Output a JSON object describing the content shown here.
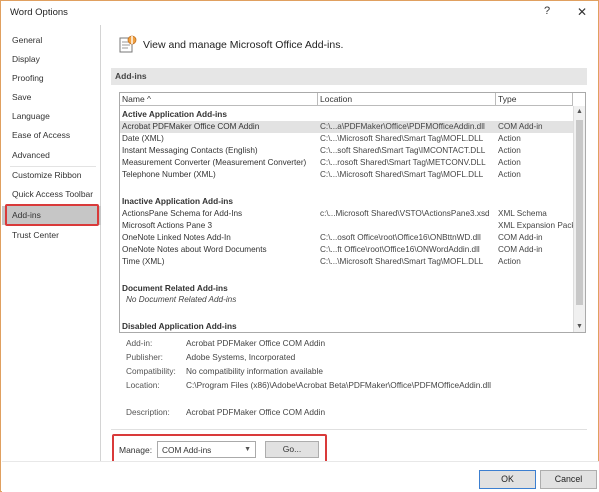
{
  "window": {
    "title": "Word Options",
    "help_glyph": "?",
    "close_glyph": "✕"
  },
  "sidebar": {
    "items": [
      {
        "label": "General"
      },
      {
        "label": "Display"
      },
      {
        "label": "Proofing"
      },
      {
        "label": "Save"
      },
      {
        "label": "Language"
      },
      {
        "label": "Ease of Access"
      },
      {
        "label": "Advanced"
      },
      {
        "label": "Customize Ribbon"
      },
      {
        "label": "Quick Access Toolbar"
      },
      {
        "label": "Add-ins"
      },
      {
        "label": "Trust Center"
      }
    ],
    "active": "Add-ins"
  },
  "main": {
    "header": "View and manage Microsoft Office Add-ins.",
    "section_title": "Add-ins",
    "columns": {
      "name": "Name ^",
      "location": "Location",
      "type": "Type"
    },
    "groups": {
      "active": "Active Application Add-ins",
      "inactive": "Inactive Application Add-ins",
      "document": "Document Related Add-ins",
      "disabled": "Disabled Application Add-ins"
    },
    "active_rows": [
      {
        "name": "Acrobat PDFMaker Office COM Addin",
        "location": "C:\\...a\\PDFMaker\\Office\\PDFMOfficeAddin.dll",
        "type": "COM Add-in"
      },
      {
        "name": "Date (XML)",
        "location": "C:\\...\\Microsoft Shared\\Smart Tag\\MOFL.DLL",
        "type": "Action"
      },
      {
        "name": "Instant Messaging Contacts (English)",
        "location": "C:\\...soft Shared\\Smart Tag\\IMCONTACT.DLL",
        "type": "Action"
      },
      {
        "name": "Measurement Converter (Measurement Converter)",
        "location": "C:\\...rosoft Shared\\Smart Tag\\METCONV.DLL",
        "type": "Action"
      },
      {
        "name": "Telephone Number (XML)",
        "location": "C:\\...\\Microsoft Shared\\Smart Tag\\MOFL.DLL",
        "type": "Action"
      }
    ],
    "inactive_rows": [
      {
        "name": "ActionsPane Schema for Add-Ins",
        "location": "c:\\...Microsoft Shared\\VSTO\\ActionsPane3.xsd",
        "type": "XML Schema"
      },
      {
        "name": "Microsoft Actions Pane 3",
        "location": "",
        "type": "XML Expansion Pack"
      },
      {
        "name": "OneNote Linked Notes Add-In",
        "location": "C:\\...osoft Office\\root\\Office16\\ONBttnWD.dll",
        "type": "COM Add-in"
      },
      {
        "name": "OneNote Notes about Word Documents",
        "location": "C:\\...ft Office\\root\\Office16\\ONWordAddin.dll",
        "type": "COM Add-in"
      },
      {
        "name": "Time (XML)",
        "location": "C:\\...\\Microsoft Shared\\Smart Tag\\MOFL.DLL",
        "type": "Action"
      }
    ],
    "document_empty": "No Document Related Add-ins",
    "details": {
      "addin_label": "Add-in:",
      "addin_value": "Acrobat PDFMaker Office COM Addin",
      "publisher_label": "Publisher:",
      "publisher_value": "Adobe Systems, Incorporated",
      "compat_label": "Compatibility:",
      "compat_value": "No compatibility information available",
      "location_label": "Location:",
      "location_value": "C:\\Program Files (x86)\\Adobe\\Acrobat Beta\\PDFMaker\\Office\\PDFMOfficeAddin.dll",
      "description_label": "Description:",
      "description_value": "Acrobat PDFMaker Office COM Addin"
    },
    "manage": {
      "label": "Manage:",
      "selected": "COM Add-ins",
      "go_label": "Go..."
    }
  },
  "footer": {
    "ok_label": "OK",
    "cancel_label": "Cancel"
  },
  "colors": {
    "highlight": "#d93a3a",
    "active_nav": "#c6c6c6",
    "selected_row": "#e2e2e2"
  }
}
